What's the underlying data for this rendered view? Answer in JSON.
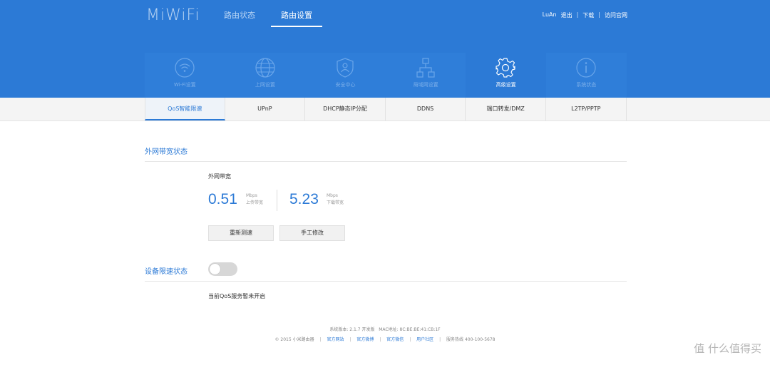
{
  "header": {
    "logo": "MiWiFi",
    "nav": [
      {
        "label": "路由状态",
        "active": false
      },
      {
        "label": "路由设置",
        "active": true
      }
    ],
    "user": {
      "name": "LuAn",
      "logout": "退出",
      "download": "下载",
      "official": "访问官网"
    }
  },
  "tiles": [
    {
      "label": "Wi-Fi设置",
      "icon": "wifi-icon"
    },
    {
      "label": "上网设置",
      "icon": "globe-icon"
    },
    {
      "label": "安全中心",
      "icon": "shield-icon"
    },
    {
      "label": "局域网设置",
      "icon": "network-icon"
    },
    {
      "label": "高级设置",
      "icon": "gear-icon",
      "active": true
    },
    {
      "label": "系统状态",
      "icon": "info-icon"
    }
  ],
  "subtabs": [
    {
      "label": "QoS智能限速",
      "active": true
    },
    {
      "label": "UPnP"
    },
    {
      "label": "DHCP静态IP分配"
    },
    {
      "label": "DDNS"
    },
    {
      "label": "端口转发/DMZ"
    },
    {
      "label": "L2TP/PPTP"
    }
  ],
  "bandwidth": {
    "section_title": "外网带宽状态",
    "label": "外网带宽",
    "upload": {
      "value": "0.51",
      "unit": "Mbps",
      "label": "上传带宽"
    },
    "download": {
      "value": "5.23",
      "unit": "Mbps",
      "label": "下载带宽"
    },
    "retest_button": "重新测速",
    "manual_button": "手工修改"
  },
  "device_limit": {
    "section_title": "设备限速状态",
    "toggle_on": false,
    "status_text": "当前QoS服务暂未开启"
  },
  "footer": {
    "version": "系统版本: 2.1.7 开发版",
    "mac": "MAC地址: 8C:BE:BE:41:CB:1F",
    "copyright": "© 2015 小米路由器",
    "links": [
      "官方网站",
      "官方微博",
      "官方微信",
      "用户社区"
    ],
    "hotline": "服务热线 400-100-5678"
  },
  "watermark": "值 什么值得买",
  "colors": {
    "brand": "#2c7ad6"
  }
}
